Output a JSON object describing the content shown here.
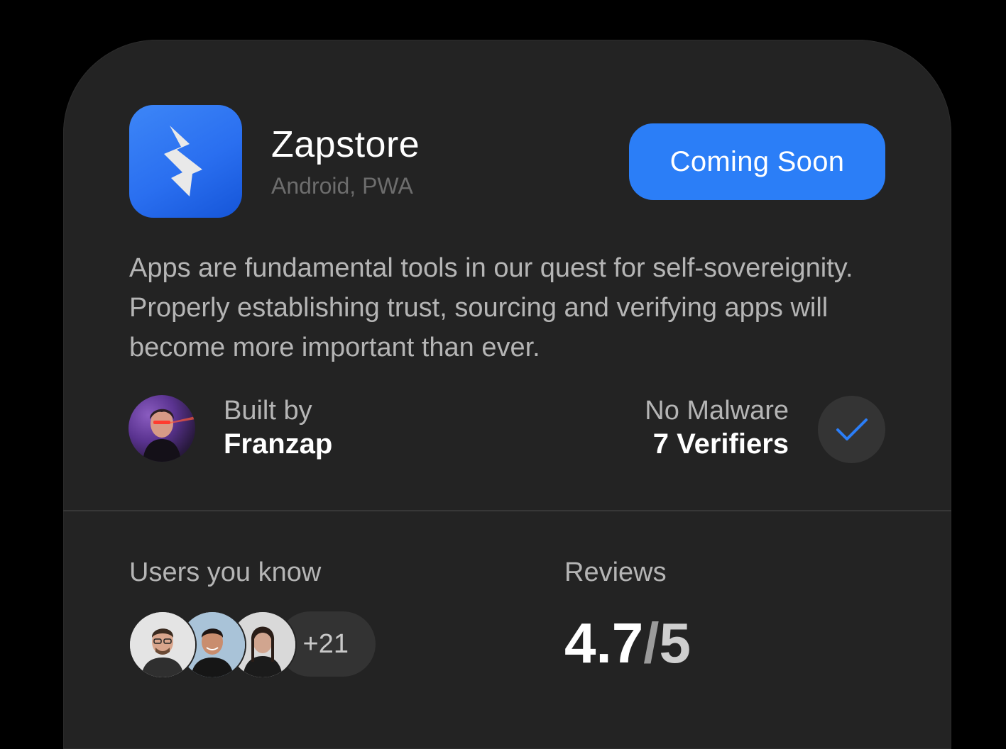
{
  "app": {
    "name": "Zapstore",
    "platforms": "Android, PWA",
    "icon": "lightning-bolt-icon",
    "cta_label": "Coming Soon",
    "description": "Apps are fundamental tools in our quest for self-sovereignity. Properly establishing trust, sourcing and verifying apps will become more important than ever."
  },
  "builder": {
    "label": "Built by",
    "name": "Franzap"
  },
  "security": {
    "label": "No Malware",
    "verifiers": "7 Verifiers",
    "icon": "checkmark-icon"
  },
  "social": {
    "users_label": "Users you know",
    "more_count": "+21"
  },
  "reviews": {
    "label": "Reviews",
    "score": "4.7",
    "slash": "/",
    "max": "5"
  },
  "colors": {
    "background": "#000000",
    "card": "#232323",
    "accent": "#2b7ef7",
    "muted_text": "#b5b5b5",
    "subtle_text": "#6d6d6d"
  }
}
